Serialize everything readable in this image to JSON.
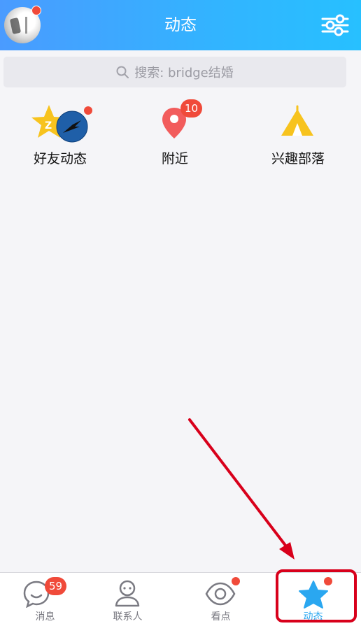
{
  "header": {
    "title": "动态",
    "avatar_icon": "user-avatar",
    "settings_icon": "sliders-icon"
  },
  "search": {
    "placeholder": "搜索: bridge结婚"
  },
  "features": [
    {
      "label": "好友动态",
      "icon": "qzone-star-icon",
      "badge": null,
      "dot": true
    },
    {
      "label": "附近",
      "icon": "location-pin-icon",
      "badge": "10",
      "dot": false
    },
    {
      "label": "兴趣部落",
      "icon": "tent-icon",
      "badge": null,
      "dot": false
    }
  ],
  "tabs": [
    {
      "label": "消息",
      "icon": "chat-bubble-icon",
      "badge": "59"
    },
    {
      "label": "联系人",
      "icon": "contacts-icon",
      "badge": null
    },
    {
      "label": "看点",
      "icon": "eye-icon",
      "badge": null
    },
    {
      "label": "动态",
      "icon": "star-icon",
      "badge": null
    }
  ],
  "colors": {
    "header_start": "#4a9bff",
    "header_end": "#27c0ff",
    "badge_red": "#f04a3a",
    "active_tab": "#2aa7f0",
    "annotation_red": "#d8001b"
  }
}
